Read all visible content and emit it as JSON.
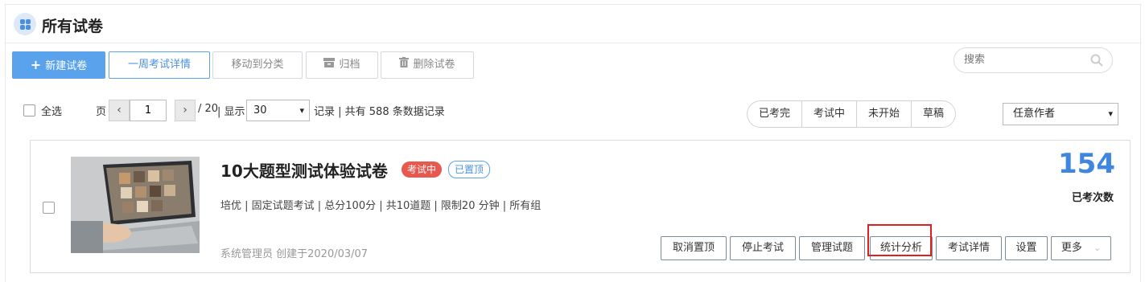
{
  "page": {
    "title": "所有试卷"
  },
  "toolbar": {
    "new_exam": "新建试卷",
    "week_detail": "一周考试详情",
    "move_category": "移动到分类",
    "archive": "归档",
    "delete": "删除试卷"
  },
  "search": {
    "placeholder": "搜索"
  },
  "pager": {
    "select_all": "全选",
    "page_label": "页",
    "prev": "‹",
    "current_page": "1",
    "next": "›",
    "total_pages": "/ 20",
    "display_label": "| 显示",
    "page_size": "30",
    "records_text": "记录 | 共有 588 条数据记录"
  },
  "filters": [
    "已考完",
    "考试中",
    "未开始",
    "草稿"
  ],
  "author_select": "任意作者",
  "exam": {
    "title": "10大题型测试体验试卷",
    "status_badge": "考试中",
    "pinned_badge": "已置顶",
    "meta": "培优 | 固定试题考试 | 总分100分 | 共10道题 | 限制20 分钟 | 所有组",
    "creator": "系统管理员   创建于2020/03/07",
    "count": "154",
    "count_label": "已考次数",
    "actions": {
      "unpin": "取消置顶",
      "stop": "停止考试",
      "manage": "管理试题",
      "stats": "统计分析",
      "details": "考试详情",
      "settings": "设置",
      "more": "更多"
    }
  },
  "colors": {
    "primary": "#5aa3ec",
    "danger": "#e8584f",
    "count": "#3f86e0",
    "highlight": "#e02020"
  }
}
